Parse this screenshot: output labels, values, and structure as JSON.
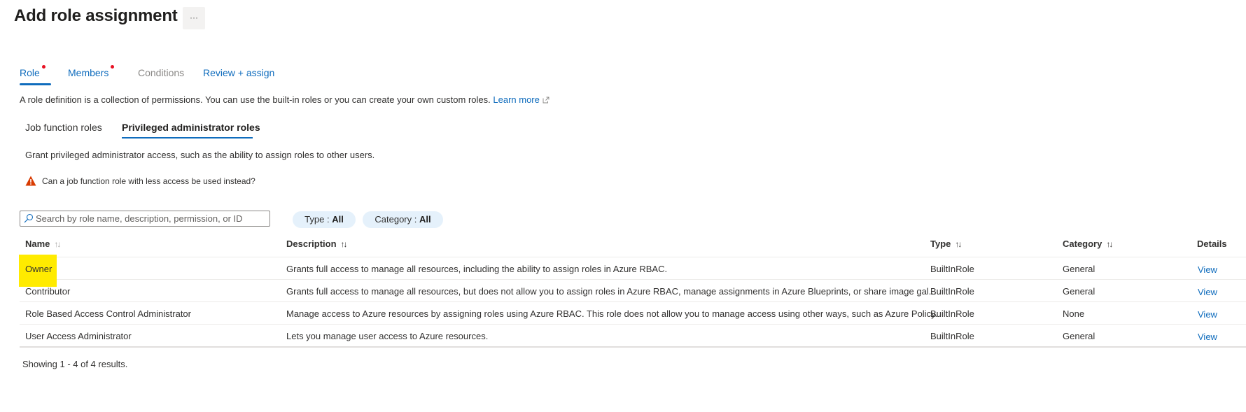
{
  "header": {
    "title": "Add role assignment",
    "more_label": "···"
  },
  "tabs": [
    {
      "label": "Role",
      "required": true,
      "active": true,
      "disabled": false
    },
    {
      "label": "Members",
      "required": true,
      "active": false,
      "disabled": false
    },
    {
      "label": "Conditions",
      "required": false,
      "active": false,
      "disabled": true
    },
    {
      "label": "Review + assign",
      "required": false,
      "active": false,
      "disabled": false
    }
  ],
  "description": {
    "text": "A role definition is a collection of permissions. You can use the built-in roles or you can create your own custom roles.",
    "link_label": "Learn more"
  },
  "subtabs": [
    {
      "label": "Job function roles",
      "active": false
    },
    {
      "label": "Privileged administrator roles",
      "active": true
    }
  ],
  "grant_text": "Grant privileged administrator access, such as the ability to assign roles to other users.",
  "warning": {
    "icon": "warning-icon",
    "text": "Can a job function role with less access be used instead?"
  },
  "search": {
    "placeholder": "Search by role name, description, permission, or ID",
    "value": ""
  },
  "filters": [
    {
      "label": "Type : ",
      "value": "All"
    },
    {
      "label": "Category : ",
      "value": "All"
    }
  ],
  "table": {
    "columns": [
      {
        "label": "Name",
        "sortable": true
      },
      {
        "label": "Description",
        "sortable": true
      },
      {
        "label": "Type",
        "sortable": true
      },
      {
        "label": "Category",
        "sortable": true
      },
      {
        "label": "Details",
        "sortable": false
      }
    ],
    "sort_glyph": "↑↓",
    "rows": [
      {
        "name": "Owner",
        "description": "Grants full access to manage all resources, including the ability to assign roles in Azure RBAC.",
        "type": "BuiltInRole",
        "category": "General",
        "details": "View",
        "highlighted": true
      },
      {
        "name": "Contributor",
        "description": "Grants full access to manage all resources, but does not allow you to assign roles in Azure RBAC, manage assignments in Azure Blueprints, or share image gal...",
        "type": "BuiltInRole",
        "category": "General",
        "details": "View",
        "highlighted": false
      },
      {
        "name": "Role Based Access Control Administrator",
        "description": "Manage access to Azure resources by assigning roles using Azure RBAC. This role does not allow you to manage access using other ways, such as Azure Policy.",
        "type": "BuiltInRole",
        "category": "None",
        "details": "View",
        "highlighted": false
      },
      {
        "name": "User Access Administrator",
        "description": "Lets you manage user access to Azure resources.",
        "type": "BuiltInRole",
        "category": "General",
        "details": "View",
        "highlighted": false
      }
    ]
  },
  "footer": {
    "showing_text": "Showing 1 - 4 of 4 results."
  },
  "colors": {
    "accent": "#0f6cbd",
    "required_dot": "#e81123",
    "highlight": "#ffeb00",
    "warning": "#d83b01",
    "pill_bg": "#e5f1fb"
  }
}
